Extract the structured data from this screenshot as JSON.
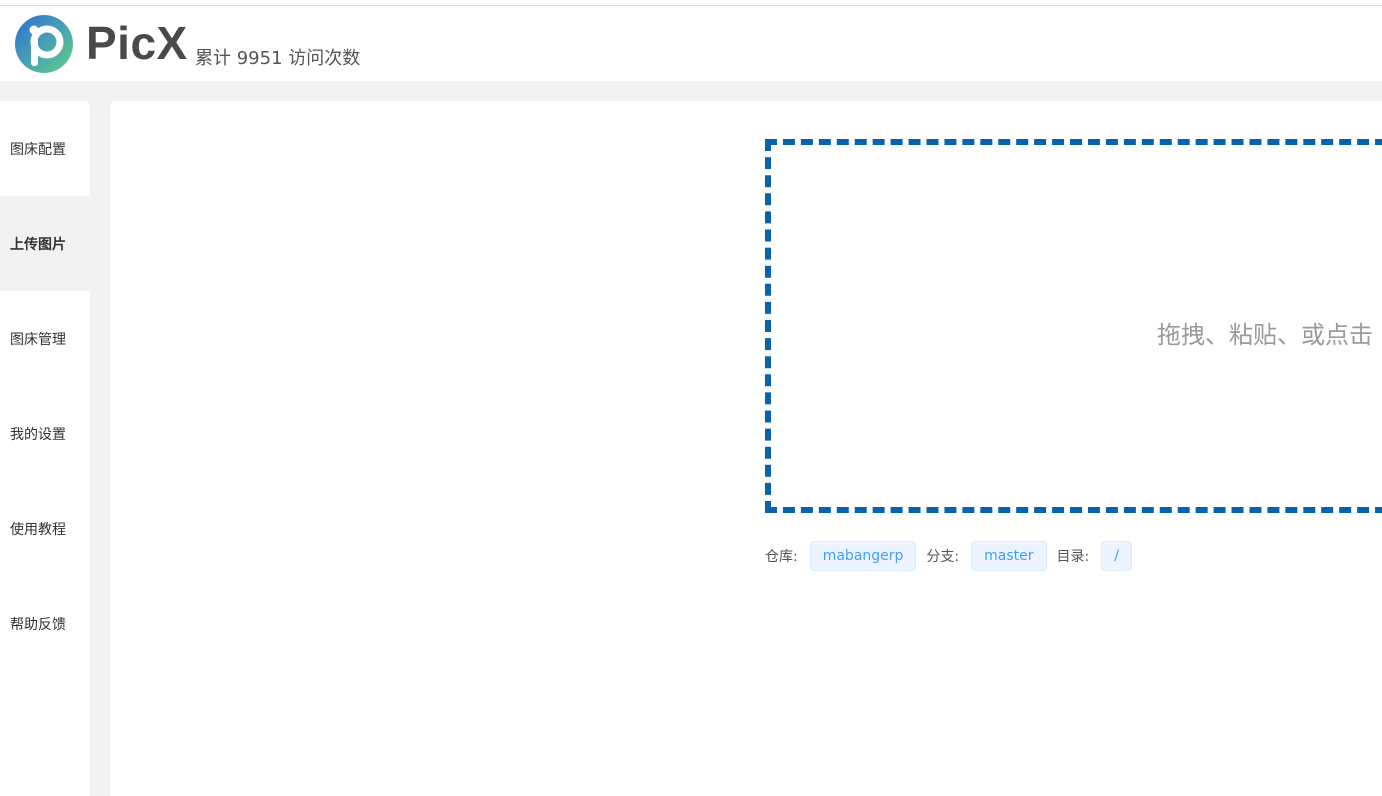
{
  "header": {
    "brand": "PicX",
    "visits": "累计 9951 访问次数",
    "colors": {
      "logo_start": "#2f6fd6",
      "logo_end": "#5fd08c"
    }
  },
  "sidebar": {
    "items": [
      {
        "label": "图床配置",
        "active": false
      },
      {
        "label": "上传图片",
        "active": true
      },
      {
        "label": "图床管理",
        "active": false
      },
      {
        "label": "我的设置",
        "active": false
      },
      {
        "label": "使用教程",
        "active": false
      },
      {
        "label": "帮助反馈",
        "active": false
      }
    ]
  },
  "upload": {
    "hint": "拖拽、粘贴、或点击",
    "border_color": "#0a62ad"
  },
  "repo": {
    "repo_label": "仓库:",
    "repo_value": "mabangerp",
    "branch_label": "分支:",
    "branch_value": "master",
    "dir_label": "目录:",
    "dir_value": "/"
  }
}
